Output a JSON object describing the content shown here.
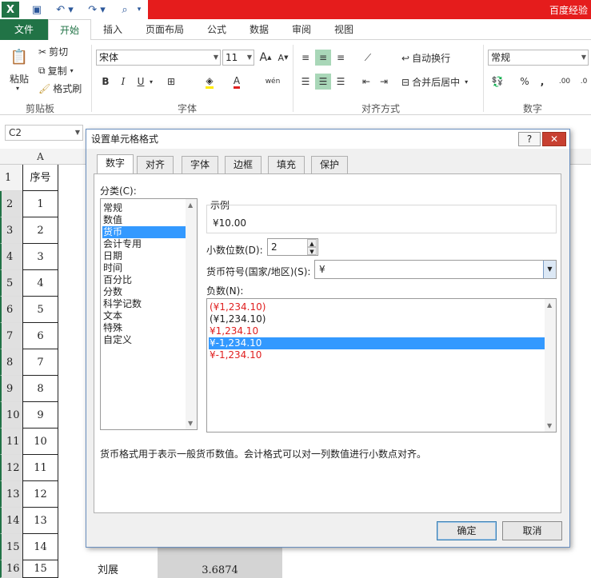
{
  "titlebar": {
    "app_title": "百度经验"
  },
  "tabs": [
    "文件",
    "开始",
    "插入",
    "页面布局",
    "公式",
    "数据",
    "审阅",
    "视图"
  ],
  "ribbon": {
    "clipboard": {
      "paste": "粘贴",
      "cut": "剪切",
      "copy": "复制",
      "painter": "格式刷",
      "label": "剪贴板"
    },
    "font": {
      "name": "宋体",
      "size": "11",
      "label": "字体",
      "bold": "B",
      "italic": "I",
      "underline": "U",
      "grow": "A",
      "shrink": "A",
      "phonetic": "wén"
    },
    "align": {
      "wrap": "自动换行",
      "merge": "合并后居中",
      "label": "对齐方式"
    },
    "number": {
      "format": "常规",
      "label": "数字",
      "percent": "%",
      "comma": ","
    }
  },
  "namebox": "C2",
  "grid": {
    "col_a": "A",
    "rows": [
      {
        "n": "1",
        "a": "序号"
      },
      {
        "n": "2",
        "a": "1"
      },
      {
        "n": "3",
        "a": "2"
      },
      {
        "n": "4",
        "a": "3"
      },
      {
        "n": "5",
        "a": "4"
      },
      {
        "n": "6",
        "a": "5"
      },
      {
        "n": "7",
        "a": "6"
      },
      {
        "n": "8",
        "a": "7"
      },
      {
        "n": "9",
        "a": "8"
      },
      {
        "n": "10",
        "a": "9"
      },
      {
        "n": "11",
        "a": "10"
      },
      {
        "n": "12",
        "a": "11"
      },
      {
        "n": "13",
        "a": "12"
      },
      {
        "n": "14",
        "a": "13"
      },
      {
        "n": "15",
        "a": "14"
      },
      {
        "n": "16",
        "a": "15"
      }
    ],
    "last_name": "刘展",
    "last_value": "3.6874"
  },
  "dialog": {
    "title": "设置单元格格式",
    "help": "?",
    "close": "✕",
    "tabs": [
      "数字",
      "对齐",
      "字体",
      "边框",
      "填充",
      "保护"
    ],
    "category_label": "分类(C):",
    "categories": [
      "常规",
      "数值",
      "货币",
      "会计专用",
      "日期",
      "时间",
      "百分比",
      "分数",
      "科学记数",
      "文本",
      "特殊",
      "自定义"
    ],
    "sample_label": "示例",
    "sample_value": "¥10.00",
    "decimals_label": "小数位数(D):",
    "decimals_value": "2",
    "symbol_label": "货币符号(国家/地区)(S):",
    "symbol_value": "¥",
    "negative_label": "负数(N):",
    "negatives": [
      {
        "text": "(¥1,234.10)",
        "color": "#e02020"
      },
      {
        "text": "(¥1,234.10)",
        "color": "#222222"
      },
      {
        "text": "¥1,234.10",
        "color": "#e02020"
      },
      {
        "text": "¥-1,234.10",
        "color": "#ffffff"
      },
      {
        "text": "¥-1,234.10",
        "color": "#e02020"
      }
    ],
    "description": "货币格式用于表示一般货币数值。会计格式可以对一列数值进行小数点对齐。",
    "ok": "确定",
    "cancel": "取消"
  }
}
